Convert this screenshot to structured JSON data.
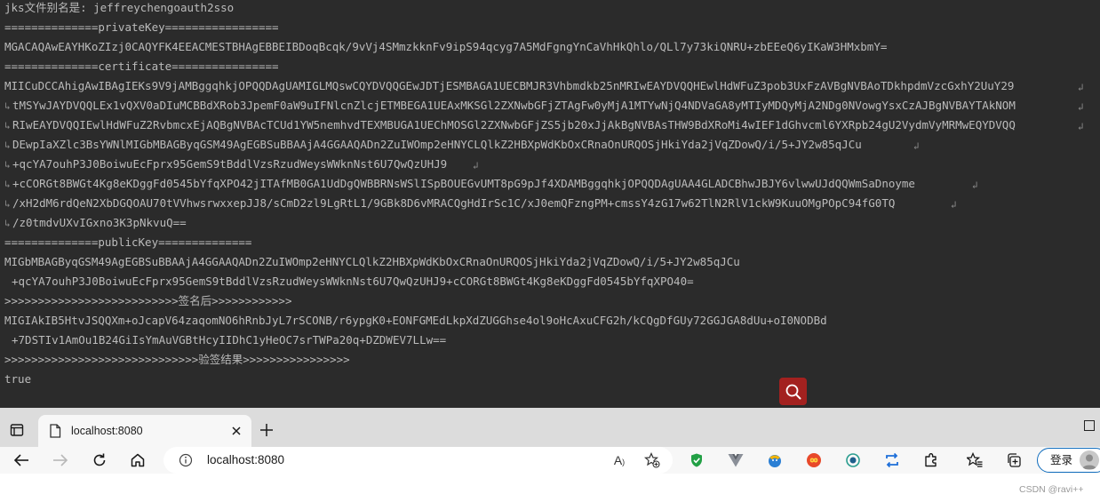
{
  "console": {
    "lines": [
      "jks文件别名是: jeffreychengoauth2sso",
      "==============privateKey=================",
      "MGACAQAwEAYHKoZIzj0CAQYFK4EEACMESTBHAgEBBEIBDoqBcqk/9vVj4SMmzkknFv9ipS94qcyg7A5MdFgngYnCaVhHkQhlo/QLl7y73kiQNRU+zbEEeQ6yIKaW3HMxbmY=",
      "==============certificate================",
      "MIICuDCCAhigAwIBAgIEKs9V9jAMBggqhkjOPQQDAgUAMIGLMQswCQYDVQQGEwJDTjESMBAGA1UECBMJR3Vhbmdkb25nMRIwEAYDVQQHEwlHdWFuZ3pob3UxFzAVBgNVBAoTDkhpdmVzcGxhY2UuY29",
      "tMSYwJAYDVQQLEx1vQXV0aDIuMCBBdXRob3JpemF0aW9uIFNlcnZlcjETMBEGA1UEAxMKSGl2ZXNwbGFjZTAgFw0yMjA1MTYwNjQ4NDVaGA8yMTIyMDQyMjA2NDg0NVowgYsxCzAJBgNVBAYTAkNOM",
      "RIwEAYDVQQIEwlHdWFuZ2RvbmcxEjAQBgNVBAcTCUd1YW5nemhvdTEXMBUGA1UEChMOSGl2ZXNwbGFjZS5jb20xJjAkBgNVBAsTHW9BdXRoMi4wIEF1dGhvcml6YXRpb24gU2VydmVyMRMwEQYDVQQ",
      "DEwpIaXZlc3BsYWNlMIGbMBAGByqGSM49AgEGBSuBBAAjA4GGAAQADn2ZuIWOmp2eHNYCLQlkZ2HBXpWdKbOxCRnaOnURQOSjHkiYda2jVqZDowQ/i/5+JY2w85qJCu",
      "+qcYA7ouhP3J0BoiwuEcFprx95GemS9tBddlVzsRzudWeysWWknNst6U7QwQzUHJ9",
      "+cCORGt8BWGt4Kg8eKDggFd0545bYfqXPO42jITAfMB0GA1UdDgQWBBRNsWSlISpBOUEGvUMT8pG9pJf4XDAMBggqhkjOPQQDAgUAA4GLADCBhwJBJY6vlwwUJdQQWmSaDnoyme",
      "/xH2dM6rdQeN2XbDGQOAU70tVVhwsrwxxepJJ8/sCmD2zl9LgRtL1/9GBk8D6vMRACQgHdIrSc1C/xJ0emQFzngPM+cmssY4zG17w62TlN2RlV1ckW9KuuOMgPOpC94fG0TQ",
      "/z0tmdvUXvIGxno3K3pNkvuQ==",
      "==============publicKey==============",
      "MIGbMBAGByqGSM49AgEGBSuBBAAjA4GGAAQADn2ZuIWOmp2eHNYCLQlkZ2HBXpWdKbOxCRnaOnURQOSjHkiYda2jVqZDowQ/i/5+JY2w85qJCu",
      "+qcYA7ouhP3J0BoiwuEcFprx95GemS9tBddlVzsRzudWeysWWknNst6U7QwQzUHJ9+cCORGt8BWGt4Kg8eKDggFd0545bYfqXPO40=",
      ">>>>>>>>>>>>>>>>>>>>>>>>>>签名后>>>>>>>>>>>>",
      "MIGIAkIB5HtvJSQQXm+oJcapV64zaqomNO6hRnbJyL7rSCONB/r6ypgK0+EONFGMEdLkpXdZUGGhse4ol9oHcAxuCFG2h/kCQgDfGUy72GGJGA8dUu+oI0NODBd",
      "+7DSTIv1AmOu1B24GiIsYmAuVGBtHcyIIDhC1yHeOC7srTWPa20q+DZDWEV7LLw==",
      ">>>>>>>>>>>>>>>>>>>>>>>>>>>>>验签结果>>>>>>>>>>>>>>>>",
      "true"
    ]
  },
  "browser": {
    "tab_title": "localhost:8080",
    "address_url": "localhost:8080",
    "signin_label": "登录"
  },
  "colors": {
    "console_bg": "#2b2b2b",
    "console_text": "#bbbbbb",
    "search_fab": "#a3211f",
    "signin_border": "#0f6cbd"
  },
  "watermark": "CSDN @ravi++"
}
